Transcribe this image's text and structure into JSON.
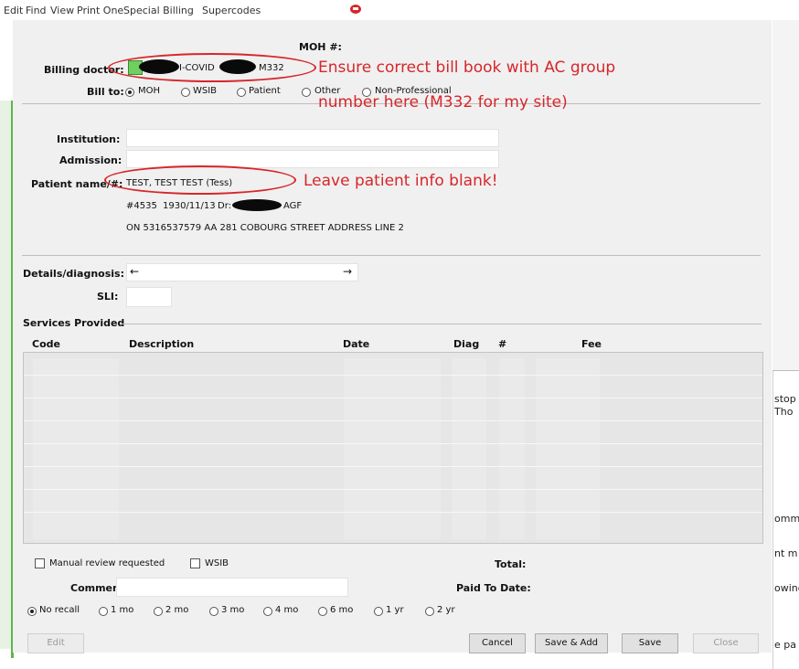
{
  "menu": {
    "items": [
      "Edit",
      "Find",
      "View",
      "Print One",
      "Special Billing",
      "Supercodes"
    ]
  },
  "header": {
    "moh_label": "MOH #:"
  },
  "billing": {
    "label": "Billing doctor:",
    "value_left": "I-COVID",
    "value_right": "M332"
  },
  "bill_to": {
    "label": "Bill to:",
    "options": [
      "MOH",
      "WSIB",
      "Patient",
      "Other",
      "Non-Professional"
    ],
    "selected": "MOH"
  },
  "institution_label": "Institution:",
  "admission_label": "Admission:",
  "patient": {
    "label": "Patient name/#:",
    "name": "TEST, TEST TEST (Tess)",
    "line2_id": "#4535",
    "line2_dob": "1930/11/13",
    "line2_dr": "Dr:",
    "line2_dr_suffix": "AGF",
    "line3": "ON 5316537579 AA   281 COBOURG STREET ADDRESS LINE 2"
  },
  "details_label": "Details/diagnosis:",
  "details_left_arrow": "←",
  "details_right_arrow": "→",
  "sli_label": "SLI:",
  "services_label": "Services Provided",
  "table": {
    "columns": [
      "Code",
      "Description",
      "Date",
      "Diag",
      "#",
      "Fee"
    ]
  },
  "manual_review_label": "Manual review requested",
  "wsib_label": "WSIB",
  "total_label": "Total:",
  "comments_label": "Comments:",
  "paid_label": "Paid To Date:",
  "recall": {
    "options": [
      "No recall",
      "1 mo",
      "2 mo",
      "3 mo",
      "4 mo",
      "6 mo",
      "1 yr",
      "2 yr"
    ],
    "selected": "No recall"
  },
  "buttons": {
    "edit": "Edit",
    "cancel": "Cancel",
    "save_add": "Save & Add",
    "save": "Save",
    "close": "Close"
  },
  "annotations": {
    "ac_group_line1": "Ensure correct bill book with AC group",
    "ac_group_line2": "number here (M332 for my site)",
    "patient_info": "Leave patient info blank!"
  },
  "right_pane_text": [
    "stop",
    "Tho",
    "omm",
    "nt m",
    "owing",
    "e pa"
  ],
  "colors": {
    "annotation": "#d7262a",
    "selected_green": "#6fcf5f",
    "dialog_bg": "#f0f0f0"
  },
  "icons": {
    "toolbar_red": "red-circle-icon"
  }
}
